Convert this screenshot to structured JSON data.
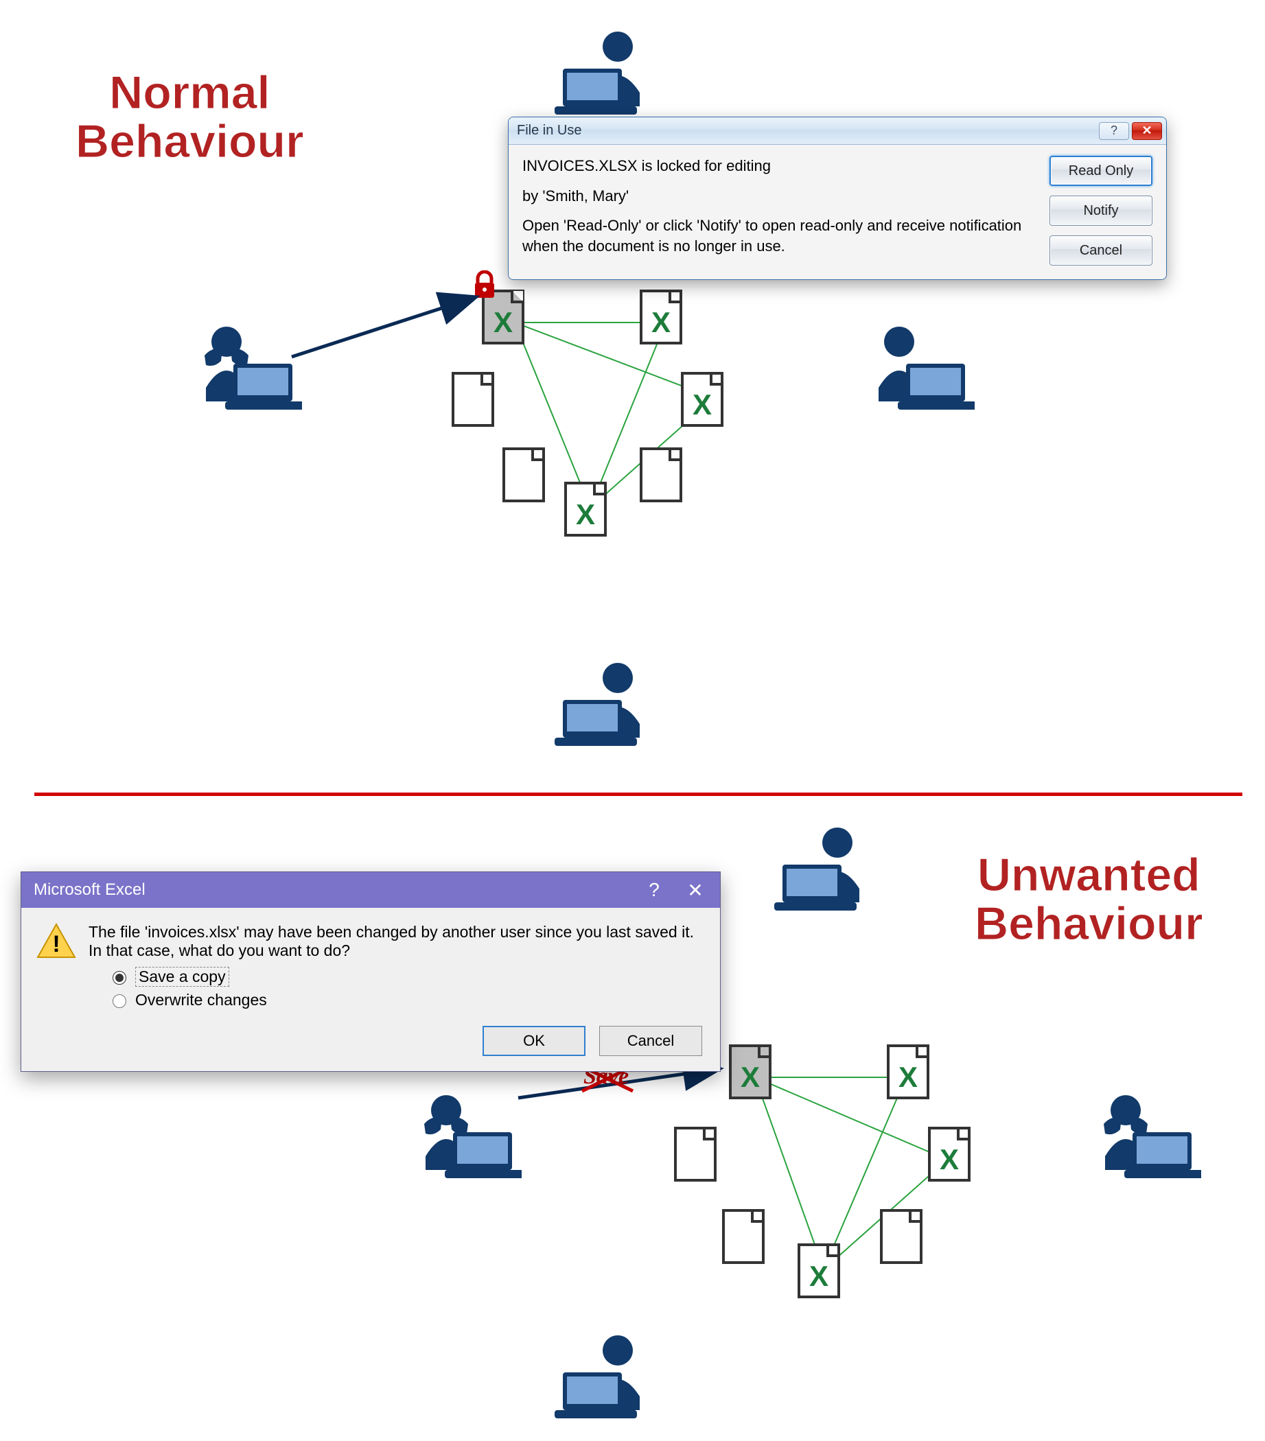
{
  "titles": {
    "normal_line1": "Normal",
    "normal_line2": "Behaviour",
    "unwanted_line1": "Unwanted",
    "unwanted_line2": "Behaviour"
  },
  "dialog_file_in_use": {
    "title": "File in Use",
    "line1": "INVOICES.XLSX is locked for editing",
    "line2": "by 'Smith, Mary'",
    "line3": "Open 'Read-Only' or click 'Notify' to open read-only and receive notification when the document is no longer in use.",
    "buttons": {
      "read_only": "Read Only",
      "notify": "Notify",
      "cancel": "Cancel"
    }
  },
  "dialog_excel_conflict": {
    "title": "Microsoft Excel",
    "message": "The file 'invoices.xlsx' may have been changed by another user since you last saved it. In that case, what do you want to do?",
    "options": {
      "save_copy": "Save a copy",
      "overwrite": "Overwrite changes"
    },
    "buttons": {
      "ok": "OK",
      "cancel": "Cancel"
    }
  },
  "labels": {
    "save_strike": "Save"
  },
  "colors": {
    "brand_red": "#b22222",
    "divider_red": "#d30000",
    "navy": "#123a6a",
    "excel_green": "#1d7c3a",
    "laptop_blue": "#7ba6d9"
  }
}
